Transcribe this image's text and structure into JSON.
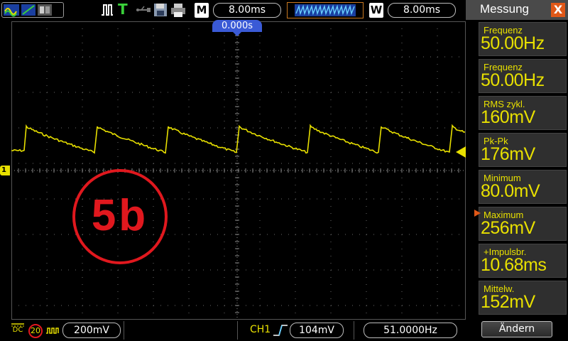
{
  "toolbar": {
    "run_icon": "waveform-run-icon",
    "trigger_mode_icon": "trigger-mode-icon",
    "trigger_type_letter": "T",
    "save_icon": "floppy-disk-icon",
    "print_icon": "printer-icon",
    "timebase_badge": "M",
    "timebase_value": "8.00ms",
    "window_badge": "W",
    "window_value": "8.00ms"
  },
  "screen": {
    "trigger_time": "0.000s",
    "channel_marker": "1",
    "stamp_text": "5b"
  },
  "panel": {
    "title": "Messung",
    "close_label": "X",
    "measurements": [
      {
        "label": "Frequenz",
        "value": "50.00Hz"
      },
      {
        "label": "Frequenz",
        "value": "50.00Hz"
      },
      {
        "label": "RMS  zykl.",
        "value": "160mV"
      },
      {
        "label": "Pk-Pk",
        "value": "176mV"
      },
      {
        "label": "Minimum",
        "value": "80.0mV"
      },
      {
        "label": "Maximum",
        "value": "256mV"
      },
      {
        "label": "+Impulsbr.",
        "value": "10.68ms"
      },
      {
        "label": "Mittelw.",
        "value": "152mV"
      }
    ],
    "selected_index": 5,
    "change_button": "Ändern"
  },
  "statusbar": {
    "coupling_label": "DC",
    "bw_limit": "20",
    "volts_per_div": "200mV",
    "trigger_source": "CH1",
    "trigger_level": "104mV",
    "frequency": "51.0000Hz"
  },
  "colors": {
    "trace": "#e8e000",
    "accent": "#e05818",
    "stamp": "#e0181e",
    "trigger_marker": "#3a5ad6"
  }
}
